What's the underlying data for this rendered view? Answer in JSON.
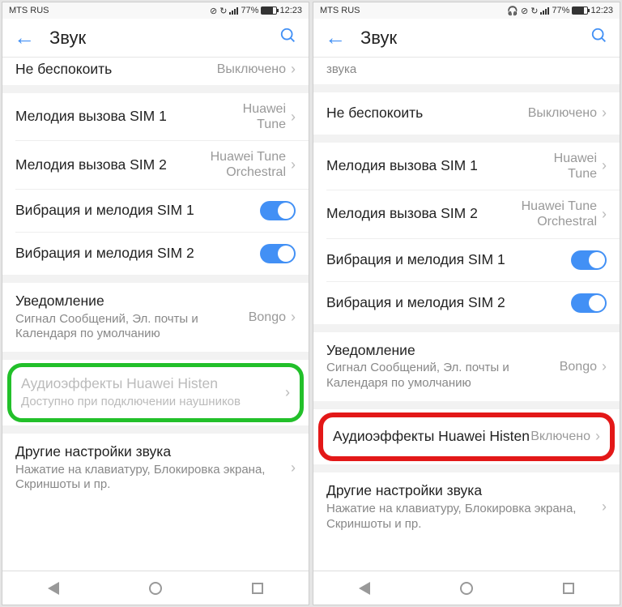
{
  "status": {
    "carrier": "MTS RUS",
    "battery": "77%",
    "time": "12:23"
  },
  "header": {
    "title": "Звук"
  },
  "left": {
    "dnd": {
      "title": "Не беспокоить",
      "value": "Выключено"
    },
    "ring1": {
      "title": "Мелодия вызова SIM 1",
      "value": "Huawei Tune"
    },
    "ring2": {
      "title": "Мелодия вызова SIM 2",
      "value": "Huawei Tune Orchestral"
    },
    "vib1": {
      "title": "Вибрация и мелодия SIM 1"
    },
    "vib2": {
      "title": "Вибрация и мелодия SIM 2"
    },
    "notif": {
      "title": "Уведомление",
      "sub": "Сигнал Сообщений, Эл. почты и Календаря по умолчанию",
      "value": "Bongo"
    },
    "histen": {
      "title": "Аудиоэффекты Huawei Histen",
      "sub": "Доступно при подключении наушников"
    },
    "other": {
      "title": "Другие настройки звука",
      "sub": "Нажатие на клавиатуру, Блокировка экрана, Скриншоты и пр."
    }
  },
  "right": {
    "zvuka": "звука",
    "dnd": {
      "title": "Не беспокоить",
      "value": "Выключено"
    },
    "ring1": {
      "title": "Мелодия вызова SIM 1",
      "value": "Huawei Tune"
    },
    "ring2": {
      "title": "Мелодия вызова SIM 2",
      "value": "Huawei Tune Orchestral"
    },
    "vib1": {
      "title": "Вибрация и мелодия SIM 1"
    },
    "vib2": {
      "title": "Вибрация и мелодия SIM 2"
    },
    "notif": {
      "title": "Уведомление",
      "sub": "Сигнал Сообщений, Эл. почты и Календаря по умолчанию",
      "value": "Bongo"
    },
    "histen": {
      "title": "Аудиоэффекты Huawei Histen",
      "value": "Включено"
    },
    "other": {
      "title": "Другие настройки звука",
      "sub": "Нажатие на клавиатуру, Блокировка экрана, Скриншоты и пр."
    }
  }
}
